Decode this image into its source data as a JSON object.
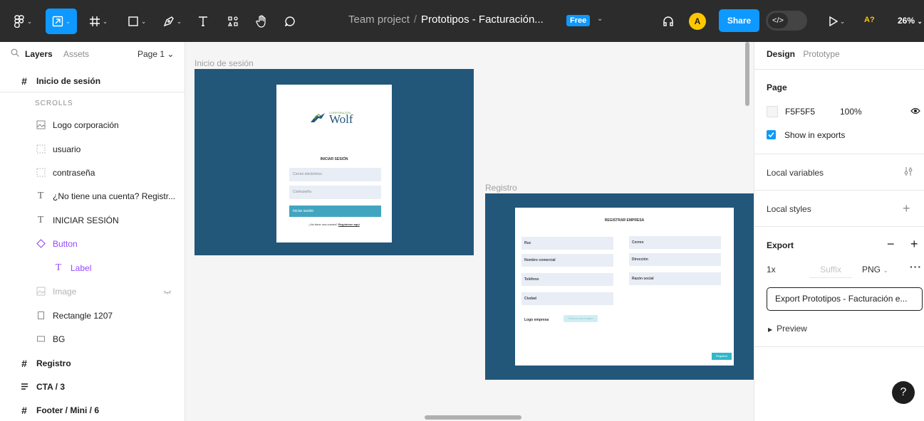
{
  "toolbar": {
    "breadcrumb_team": "Team project",
    "breadcrumb_sep": "/",
    "file_name": "Prototipos - Facturación...",
    "plan_badge": "Free",
    "avatar_initial": "A",
    "share_label": "Share",
    "dev_mode_icon": "</>",
    "accessibility_label": "A?",
    "zoom_label": "26%",
    "icons": [
      "figma-menu-icon",
      "move-tool-icon",
      "frame-tool-icon",
      "shape-tool-icon",
      "pen-tool-icon",
      "text-tool-icon",
      "resources-icon",
      "hand-tool-icon",
      "comment-tool-icon",
      "headphones-icon",
      "present-icon"
    ]
  },
  "left_panel": {
    "tab_layers": "Layers",
    "tab_assets": "Assets",
    "page_selector": "Page 1 ⌄",
    "scrolls_label": "SCROLLS",
    "layers": [
      {
        "label": "Inicio de sesión",
        "icon": "frame-icon"
      },
      {
        "label": "Logo corporación",
        "icon": "image-icon"
      },
      {
        "label": "usuario",
        "icon": "group-dotted-icon"
      },
      {
        "label": "contraseña",
        "icon": "group-dotted-icon"
      },
      {
        "label": "¿No tiene una cuenta? Registr...",
        "icon": "text-icon"
      },
      {
        "label": "INICIAR SESIÓN",
        "icon": "text-icon"
      },
      {
        "label": "Button",
        "icon": "component-instance-icon"
      },
      {
        "label": "Label",
        "icon": "text-icon"
      },
      {
        "label": "Image",
        "icon": "image-icon"
      },
      {
        "label": "Rectangle 1207",
        "icon": "rectangle-icon"
      },
      {
        "label": "BG",
        "icon": "rectangle-icon"
      },
      {
        "label": "Registro",
        "icon": "frame-icon"
      },
      {
        "label": "CTA / 3",
        "icon": "auto-layout-icon"
      },
      {
        "label": "Footer / Mini / 6",
        "icon": "frame-icon"
      }
    ]
  },
  "canvas": {
    "frame1_label": "Inicio de sesión",
    "frame2_label": "Registro",
    "login": {
      "brand_small": "CORPORACIÓN",
      "brand": "Wolf",
      "title": "INICIAR SESIÓN",
      "email_placeholder": "Correo electrónico",
      "password_placeholder": "Contraseña",
      "button": "Iniciar sesión",
      "link_text": "¿No tiene una cuenta?",
      "link_action": "Regístrese aquí"
    },
    "register": {
      "title": "REGISTRAR EMPRESA",
      "fields_left": [
        "Ruc",
        "Nombre comercial",
        "Teléfono",
        "Ciudad"
      ],
      "fields_right": [
        "Correo",
        "Dirección",
        "Razón social"
      ],
      "logo_label": "Logo empresa",
      "logo_button": "Seleccionar imagen",
      "submit": "Registrar"
    }
  },
  "right_panel": {
    "tab_design": "Design",
    "tab_prototype": "Prototype",
    "page_heading": "Page",
    "page_color_hex": "F5F5F5",
    "page_opacity": "100%",
    "show_in_exports": "Show in exports",
    "local_variables": "Local variables",
    "local_styles": "Local styles",
    "export_heading": "Export",
    "export_scale": "1x",
    "export_suffix_placeholder": "Suffix",
    "export_format": "PNG",
    "export_button": "Export Prototipos - Facturación e...",
    "preview_label": "Preview",
    "help_label": "?",
    "colors": {
      "accent": "#0d99ff",
      "frame_bg": "#22577a",
      "component": "#9747ff"
    }
  }
}
